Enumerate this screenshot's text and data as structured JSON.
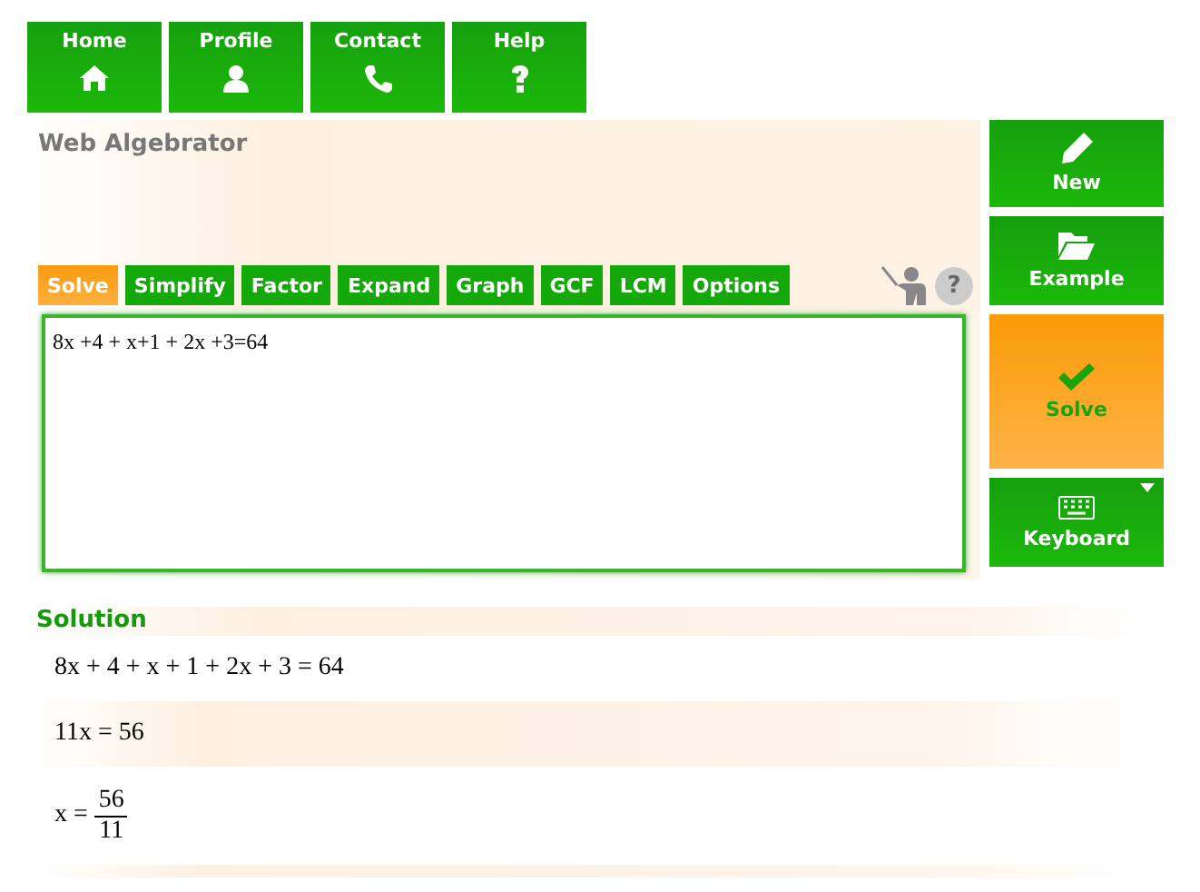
{
  "nav": [
    {
      "label": "Home"
    },
    {
      "label": "Profile"
    },
    {
      "label": "Contact"
    },
    {
      "label": "Help"
    }
  ],
  "title": "Web Algebrator",
  "tabs": [
    {
      "label": "Solve",
      "selected": true
    },
    {
      "label": "Simplify",
      "selected": false
    },
    {
      "label": "Factor",
      "selected": false
    },
    {
      "label": "Expand",
      "selected": false
    },
    {
      "label": "Graph",
      "selected": false
    },
    {
      "label": "GCF",
      "selected": false
    },
    {
      "label": "LCM",
      "selected": false
    },
    {
      "label": "Options",
      "selected": false
    }
  ],
  "help_button": "?",
  "input": {
    "value": "8x +4 + x+1 + 2x +3=64"
  },
  "side_buttons": [
    {
      "label": "New",
      "selected": false,
      "dropdown": false
    },
    {
      "label": "Example",
      "selected": false,
      "dropdown": false
    },
    {
      "label": "Solve",
      "selected": true,
      "dropdown": false
    },
    {
      "label": "Keyboard",
      "selected": false,
      "dropdown": true
    }
  ],
  "solution": {
    "heading": "Solution",
    "steps": [
      {
        "kind": "line",
        "text": "8x + 4 + x + 1 + 2x + 3 = 64"
      },
      {
        "kind": "line",
        "text": "11x = 56"
      },
      {
        "kind": "fraction",
        "text": "x =",
        "numerator": "56",
        "denominator": "11"
      }
    ]
  }
}
